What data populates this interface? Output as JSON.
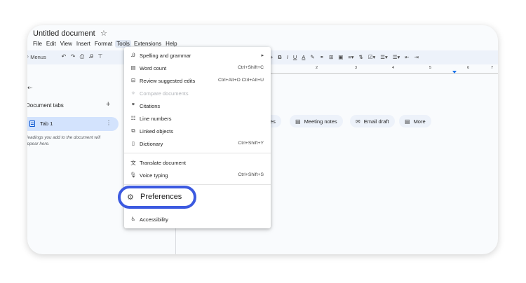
{
  "document": {
    "title": "Untitled document"
  },
  "menubar": [
    "File",
    "Edit",
    "View",
    "Insert",
    "Format",
    "Tools",
    "Extensions",
    "Help"
  ],
  "toolbar": {
    "menus_label": "Menus",
    "right_items": [
      "+",
      "B",
      "I",
      "U",
      "A"
    ]
  },
  "ruler": {
    "numbers": [
      "2",
      "3",
      "4",
      "5",
      "6",
      "7"
    ]
  },
  "sidebar": {
    "heading": "Document tabs",
    "tab_label": "Tab 1",
    "hint": "Headings you add to the document will appear here."
  },
  "chips": [
    {
      "icon": "templates-icon",
      "label": "lates"
    },
    {
      "icon": "document-icon",
      "label": "Meeting notes"
    },
    {
      "icon": "email-icon",
      "label": "Email draft"
    },
    {
      "icon": "more-icon",
      "label": "More"
    }
  ],
  "tools_menu": {
    "items": [
      {
        "label": "Spelling and grammar",
        "shortcut": "",
        "submenu": true,
        "disabled": false
      },
      {
        "label": "Word count",
        "shortcut": "Ctrl+Shift+C",
        "disabled": false
      },
      {
        "label": "Review suggested edits",
        "shortcut": "Ctrl+Alt+O Ctrl+Alt+U",
        "disabled": false
      },
      {
        "label": "Compare documents",
        "shortcut": "",
        "disabled": true
      },
      {
        "label": "Citations",
        "shortcut": "",
        "disabled": false
      },
      {
        "label": "Line numbers",
        "shortcut": "",
        "disabled": false
      },
      {
        "label": "Linked objects",
        "shortcut": "",
        "disabled": false
      },
      {
        "label": "Dictionary",
        "shortcut": "Ctrl+Shift+Y",
        "disabled": false
      },
      {
        "label": "Translate document",
        "shortcut": "",
        "disabled": false
      },
      {
        "label": "Voice typing",
        "shortcut": "Ctrl+Shift+S",
        "disabled": false
      },
      {
        "label": "Preferences",
        "shortcut": "",
        "disabled": false,
        "highlighted": true
      },
      {
        "label": "Accessibility",
        "shortcut": "",
        "disabled": false
      }
    ],
    "submenu_arrow": "▸"
  },
  "colors": {
    "highlight_ring": "#3c5ae0",
    "active_tab_bg": "#d3e3fd",
    "toolbar_bg": "#edf2fa"
  }
}
